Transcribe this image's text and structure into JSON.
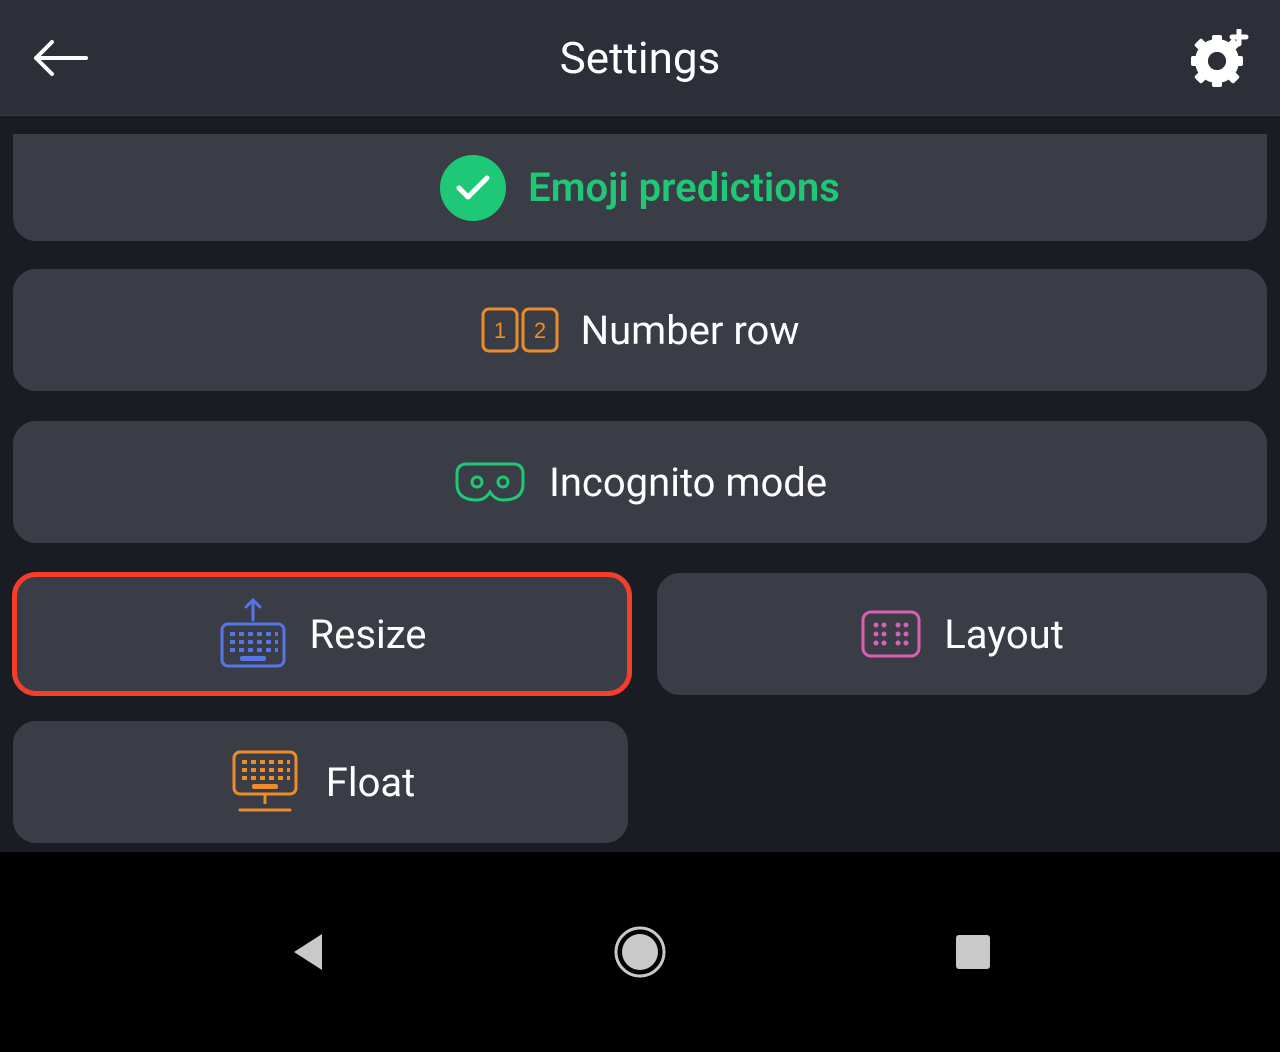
{
  "header": {
    "title": "Settings"
  },
  "cards": {
    "emoji_predictions": "Emoji predictions",
    "number_row": "Number row",
    "incognito_mode": "Incognito mode",
    "resize": "Resize",
    "layout": "Layout",
    "float": "Float"
  },
  "colors": {
    "accent_green": "#1ec876",
    "accent_orange": "#ec8d2d",
    "accent_blue": "#5577e5",
    "accent_pink": "#d762b4",
    "highlight_red": "#f43e2c",
    "card_bg": "#3a3c46",
    "page_bg": "#1a1c23"
  }
}
